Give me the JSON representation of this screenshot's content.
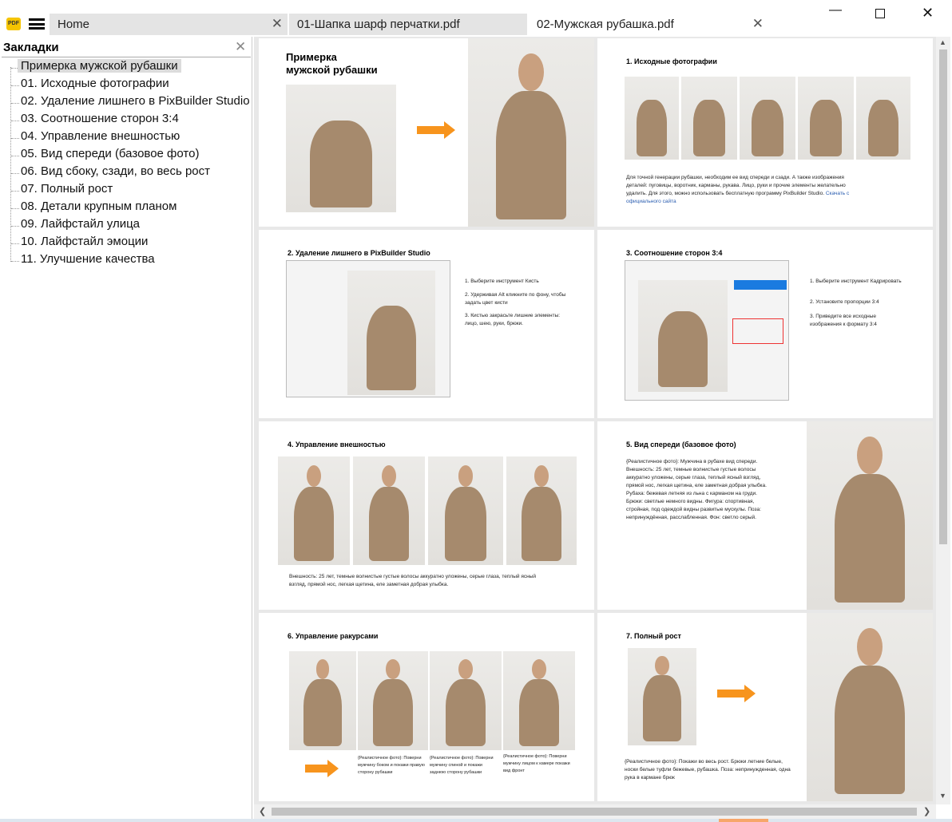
{
  "tabs": [
    {
      "label": "Home"
    },
    {
      "label": "01-Шапка шарф перчатки.pdf"
    },
    {
      "label": "02-Мужская рубашка.pdf"
    }
  ],
  "sidebar": {
    "title": "Закладки",
    "items": [
      "Примерка мужской рубашки",
      "01. Исходные фотографии",
      "02. Удаление лишнего в PixBuilder Studio",
      "03. Соотношение сторон 3:4",
      "04. Управление внешностью",
      "05. Вид спереди (базовое фото)",
      "06. Вид сбоку, сзади, во весь рост",
      "07. Полный рост",
      "08. Детали крупным планом",
      "09. Лайфстайл улица",
      "10. Лайфстайл эмоции",
      "11. Улучшение качества"
    ]
  },
  "pages": {
    "p0": {
      "title1": "Примерка",
      "title2": "мужской рубашки"
    },
    "p1": {
      "title": "1. Исходные фотографии",
      "text": "Для точной генерации рубашки, необходим ее вид спереди и сзади. А также изображения деталей: пуговицы, воротник, карманы, рукава. Лицо, руки и прочие элементы желательно удалить. Для этого, можно использовать бесплатную программу PixBuilder Studio.",
      "link": "Скачать с официального сайта"
    },
    "p2": {
      "title": "2. Удаление лишнего в PixBuilder Studio",
      "s1": "1. Выберите инструмент Кисть",
      "s2": "2. Удерживая Alt кликните по фону, чтобы задать цвет кисти",
      "s3": "3. Кистью закрасьте лишние элементы: лицо, шею, руки, брюки."
    },
    "p3": {
      "title": "3. Соотношение сторон 3:4",
      "s1": "1. Выберите инструмент Кадрировать",
      "s2": "2. Установите пропорции 3:4",
      "s3": "3. Приведите все исходные изображения к формату 3:4"
    },
    "p4": {
      "title": "4. Управление внешностью",
      "text": "Внешность: 25 лет, темные волнистые густые волосы аккуратно уложены, серые глаза, теплый ясный взгляд, прямой нос, легкая щетина, еле заметная добрая улыбка."
    },
    "p5": {
      "title": "5. Вид спереди (базовое фото)",
      "text": "{Реалистичное фото}: Мужчина в рубахе вид спереди. Внешность: 25 лет, темные волнистые густые волосы аккуратно уложены, серые глаза, теплый ясный взгляд, прямой нос, легкая щетина, еле заметная добрая улыбка. Рубаха: бежевая летняя из льна с карманом на груди. Брюки: светлые немного видны. Фигура: спортивная, стройная, под одеждой видны развитые мускулы. Поза: непринуждённая, расслабленная. Фон: светло серый."
    },
    "p6": {
      "title": "6. Управление ракурсами",
      "c1": "{Реалистичное фото}: Поверни мужчину боком и покажи правую сторону рубашки",
      "c2": "{Реалистичное фото}: Поверни мужчину спиной и покажи заднюю сторону рубашки",
      "c3": "{Реалистичное фото}: Поверни мужчину лицом к камере покажи вид фронт"
    },
    "p7": {
      "title": "7. Полный рост",
      "text": "{Реалистичное фото}: Покажи во весь рост. Брюки летние белые, носки белые туфли бежевые, рубашка. Поза: непринужденная, одна рука в кармане брюк"
    }
  },
  "colors": {
    "accent": "#f7941d",
    "shirt": "#a68a6d"
  }
}
